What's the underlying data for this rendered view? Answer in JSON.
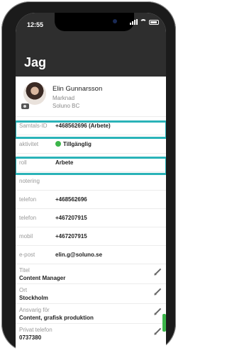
{
  "status_bar": {
    "time": "12:55"
  },
  "header": {
    "title": "Jag"
  },
  "profile": {
    "name": "Elin Gunnarsson",
    "department": "Marknad",
    "company": "Soluno BC"
  },
  "fields": [
    {
      "label": "Samtals-ID",
      "value": "+468562696 (Arbete)"
    },
    {
      "label": "aktivitet",
      "value": "Tillgänglig"
    },
    {
      "label": "roll",
      "value": "Arbete"
    },
    {
      "label": "notering",
      "value": ""
    },
    {
      "label": "telefon",
      "value": "+468562696"
    },
    {
      "label": "telefon",
      "value": "+467207915"
    },
    {
      "label": "mobil",
      "value": "+467207915"
    },
    {
      "label": "e-post",
      "value": "elin.g@soluno.se"
    }
  ],
  "details": [
    {
      "label": "Titel",
      "value": "Content Manager"
    },
    {
      "label": "Ort",
      "value": "Stockholm"
    },
    {
      "label": "Ansvarig för",
      "value": "Content, grafisk produktion"
    },
    {
      "label": "Privat telefon",
      "value": "0737380"
    }
  ],
  "colors": {
    "highlight": "#2ab3b8",
    "available": "#3cb54a",
    "header_bg": "#2e2e2e"
  }
}
